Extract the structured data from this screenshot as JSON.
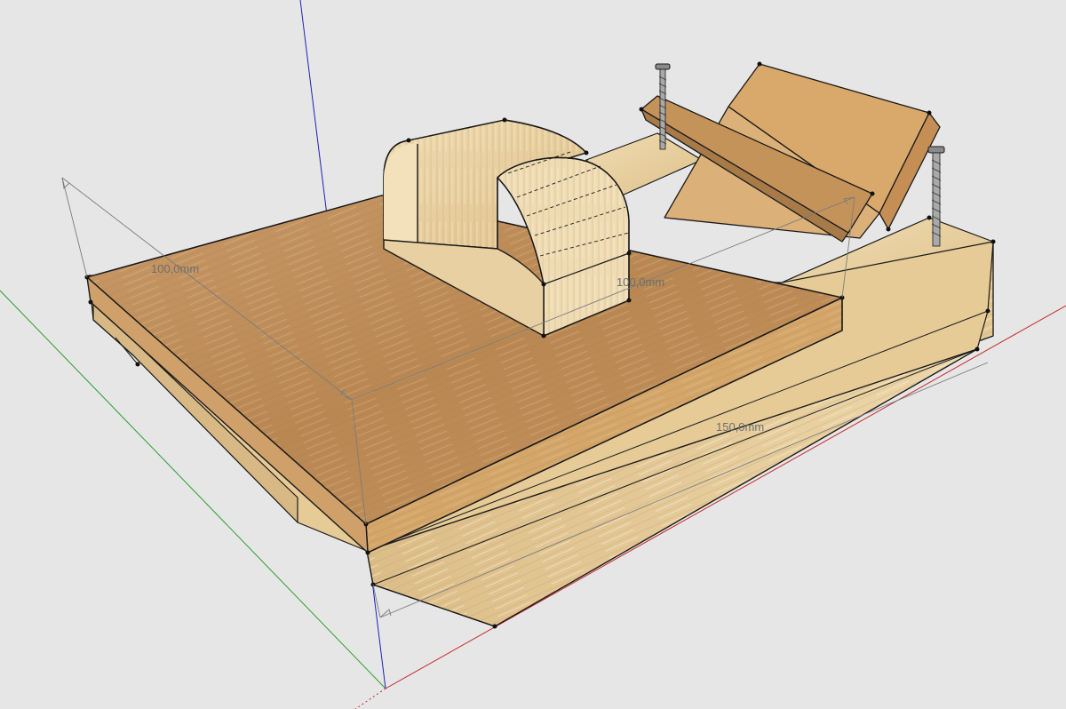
{
  "viewport": {
    "background": "#e6e6e6",
    "axis_colors": {
      "red": "#c62828",
      "green": "#2e9e2e",
      "blue": "#1f1fb8"
    }
  },
  "model": {
    "wood_colors": {
      "dark": "#c99a63",
      "light": "#e8cf9d",
      "edge": "#1a1a1a"
    },
    "screw_icon": "screw-icon"
  },
  "dimensions": [
    {
      "id": "left",
      "text": "100,0mm"
    },
    {
      "id": "right",
      "text": "100,0mm"
    },
    {
      "id": "front",
      "text": "150,0mm"
    }
  ]
}
